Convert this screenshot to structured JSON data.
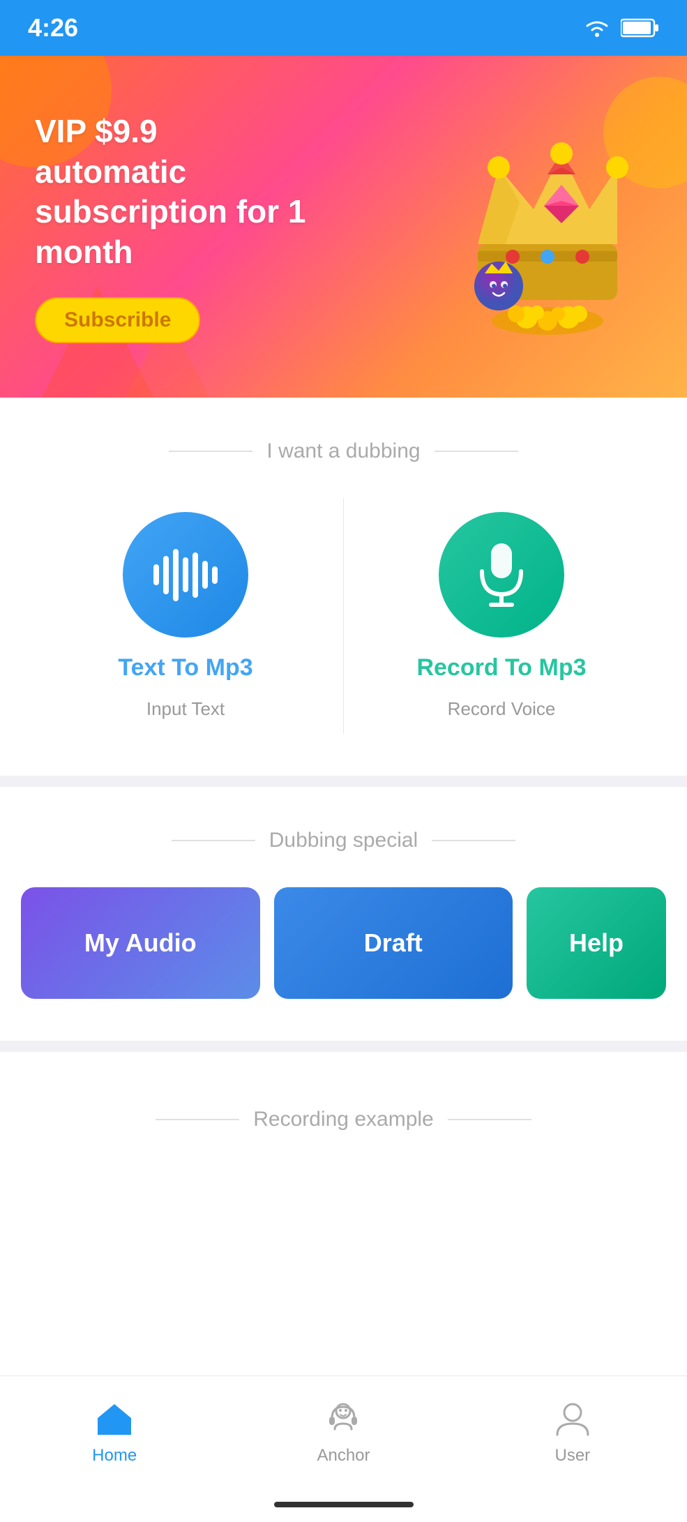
{
  "statusBar": {
    "time": "4:26"
  },
  "banner": {
    "title": "VIP $9.9 automatic subscription for 1 month",
    "subscribeLabel": "Subscrible"
  },
  "dubbingSection": {
    "sectionTitle": "I want a dubbing",
    "items": [
      {
        "id": "tts",
        "label": "Text To Mp3",
        "sublabel": "Input Text",
        "iconType": "wave"
      },
      {
        "id": "record",
        "label": "Record To Mp3",
        "sublabel": "Record Voice",
        "iconType": "mic"
      }
    ]
  },
  "specialSection": {
    "sectionTitle": "Dubbing special",
    "cards": [
      {
        "id": "my-audio",
        "label": "My Audio"
      },
      {
        "id": "draft",
        "label": "Draft"
      },
      {
        "id": "help",
        "label": "Help"
      }
    ]
  },
  "recordingSection": {
    "sectionTitle": "Recording example"
  },
  "bottomNav": {
    "items": [
      {
        "id": "home",
        "label": "Home",
        "active": true
      },
      {
        "id": "anchor",
        "label": "Anchor",
        "active": false
      },
      {
        "id": "user",
        "label": "User",
        "active": false
      }
    ]
  }
}
